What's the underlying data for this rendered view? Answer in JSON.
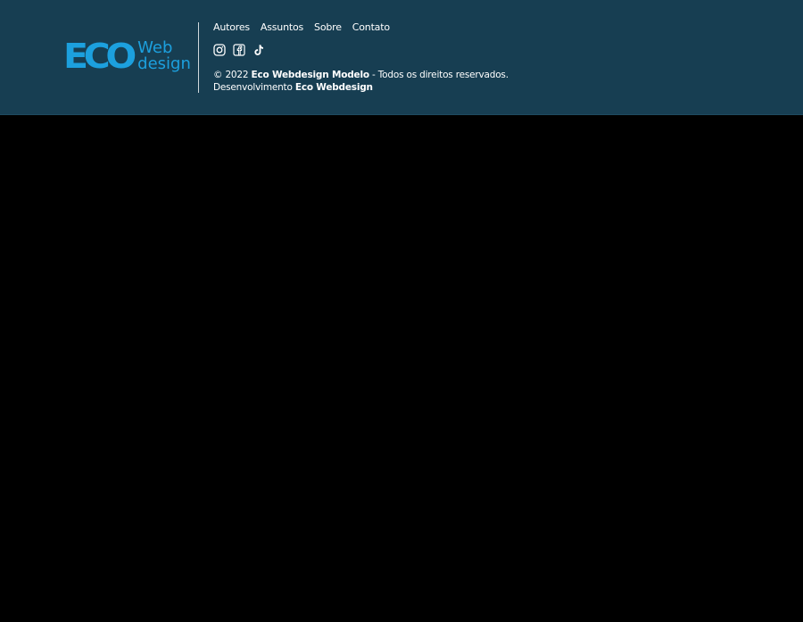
{
  "logo": {
    "eco": "ECO",
    "web": "Web",
    "design": "design"
  },
  "nav": {
    "items": [
      "Autores",
      "Assuntos",
      "Sobre",
      "Contato"
    ]
  },
  "social": {
    "icons": [
      "instagram-icon",
      "facebook-icon",
      "tiktok-icon"
    ]
  },
  "copyright": {
    "prefix": "© 2022",
    "brand": "Eco Webdesign Modelo",
    "suffix": "- Todos os direitos reservados.",
    "dev_prefix": "Desenvolvimento",
    "dev_brand": "Eco Webdesign"
  },
  "colors": {
    "footer_bg": "#173e52",
    "logo_blue": "#1ca0de",
    "page_bg": "#000000",
    "text": "#ffffff"
  }
}
